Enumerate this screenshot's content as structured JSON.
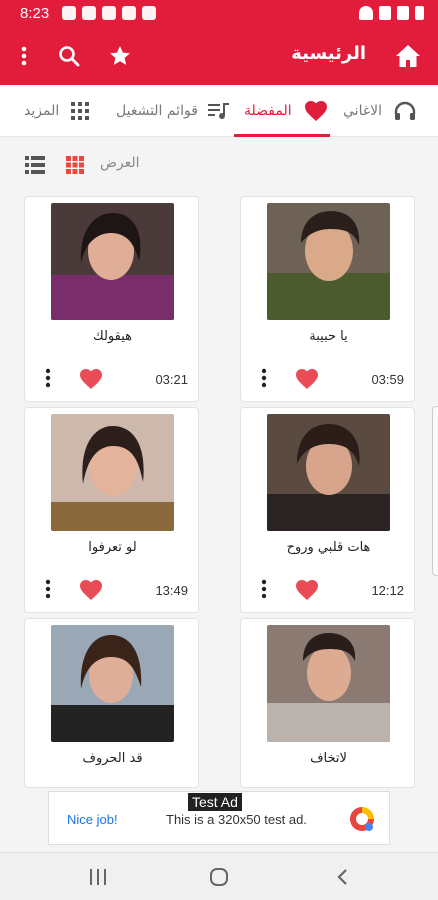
{
  "status_bar": {
    "time": "8:23"
  },
  "toolbar": {
    "title": "الرئيسية"
  },
  "tabs": [
    {
      "label": "الاغاني"
    },
    {
      "label": "المفضلة"
    },
    {
      "label": "قوائم التشغيل"
    },
    {
      "label": "المزيد"
    }
  ],
  "view": {
    "label": "العرض"
  },
  "songs": [
    {
      "name": "يا حبيبة",
      "duration": "03:59"
    },
    {
      "name": "هيقولك",
      "duration": "03:21"
    },
    {
      "name": "هات قلبي وروح",
      "duration": "12:12"
    },
    {
      "name": "لو تعرفوا",
      "duration": "13:49"
    },
    {
      "name": "لاتخاف",
      "duration": ""
    },
    {
      "name": "قد الحروف",
      "duration": ""
    }
  ],
  "ad": {
    "label": "Test Ad",
    "cta": "Nice job!",
    "text": "This is a 320x50 test ad."
  },
  "colors": {
    "accent": "#e21d3c"
  }
}
